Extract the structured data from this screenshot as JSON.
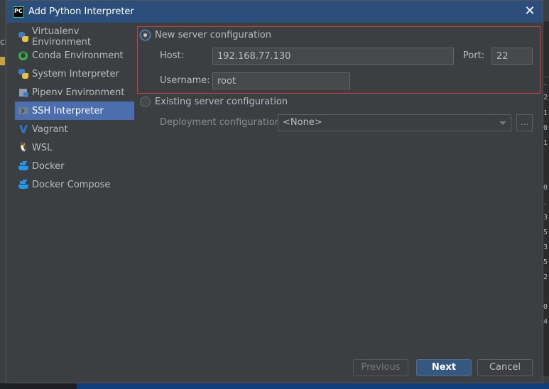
{
  "window": {
    "title": "Add Python Interpreter",
    "app_icon_text": "PC"
  },
  "sidebar": {
    "items": [
      {
        "label": "Virtualenv Environment",
        "icon": "python-icon"
      },
      {
        "label": "Conda Environment",
        "icon": "conda-icon"
      },
      {
        "label": "System Interpreter",
        "icon": "python-icon"
      },
      {
        "label": "Pipenv Environment",
        "icon": "pipenv-icon"
      },
      {
        "label": "SSH Interpreter",
        "icon": "ssh-icon",
        "selected": true
      },
      {
        "label": "Vagrant",
        "icon": "vagrant-icon"
      },
      {
        "label": "WSL",
        "icon": "wsl-icon"
      },
      {
        "label": "Docker",
        "icon": "docker-icon"
      },
      {
        "label": "Docker Compose",
        "icon": "docker-icon"
      }
    ]
  },
  "new_server": {
    "radio_label": "New server configuration",
    "selected": true,
    "host_label": "Host:",
    "host_value": "192.168.77.130",
    "port_label": "Port:",
    "port_value": "22",
    "username_label": "Username:",
    "username_value": "root"
  },
  "existing_server": {
    "radio_label": "Existing server configuration",
    "selected": false,
    "deployment_label": "Deployment configuration:",
    "deployment_value": "<None>",
    "browse_label": "..."
  },
  "buttons": {
    "previous": "Previous",
    "next": "Next",
    "cancel": "Cancel"
  },
  "background_ide": {
    "left_text": "ci",
    "right_chars": [
      ".",
      "2",
      "1",
      "0",
      "1",
      "0",
      ".",
      "3",
      "5",
      "3",
      "5",
      "2",
      "0",
      "4"
    ]
  },
  "colors": {
    "titlebar": "#2b4f7a",
    "selection": "#4b6eaf",
    "highlight_border": "#d13b3b",
    "primary_button": "#365880"
  }
}
